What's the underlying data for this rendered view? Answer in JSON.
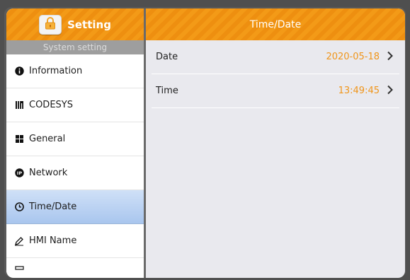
{
  "sidebar": {
    "header_title": "Setting",
    "section_label": "System setting",
    "items": [
      {
        "label": "Information",
        "icon": "info-icon"
      },
      {
        "label": "CODESYS",
        "icon": "codesys-icon"
      },
      {
        "label": "General",
        "icon": "grid-icon"
      },
      {
        "label": "Network",
        "icon": "ip-icon"
      },
      {
        "label": "Time/Date",
        "icon": "clock-icon",
        "active": true
      },
      {
        "label": "HMI Name",
        "icon": "pen-icon"
      }
    ]
  },
  "main": {
    "title": "Time/Date",
    "rows": [
      {
        "label": "Date",
        "value": "2020-05-18"
      },
      {
        "label": "Time",
        "value": "13:49:45"
      }
    ]
  },
  "colors": {
    "header_orange": "#f39a17",
    "value_orange": "#f0951a",
    "active_blue": "#a9c6ee"
  }
}
